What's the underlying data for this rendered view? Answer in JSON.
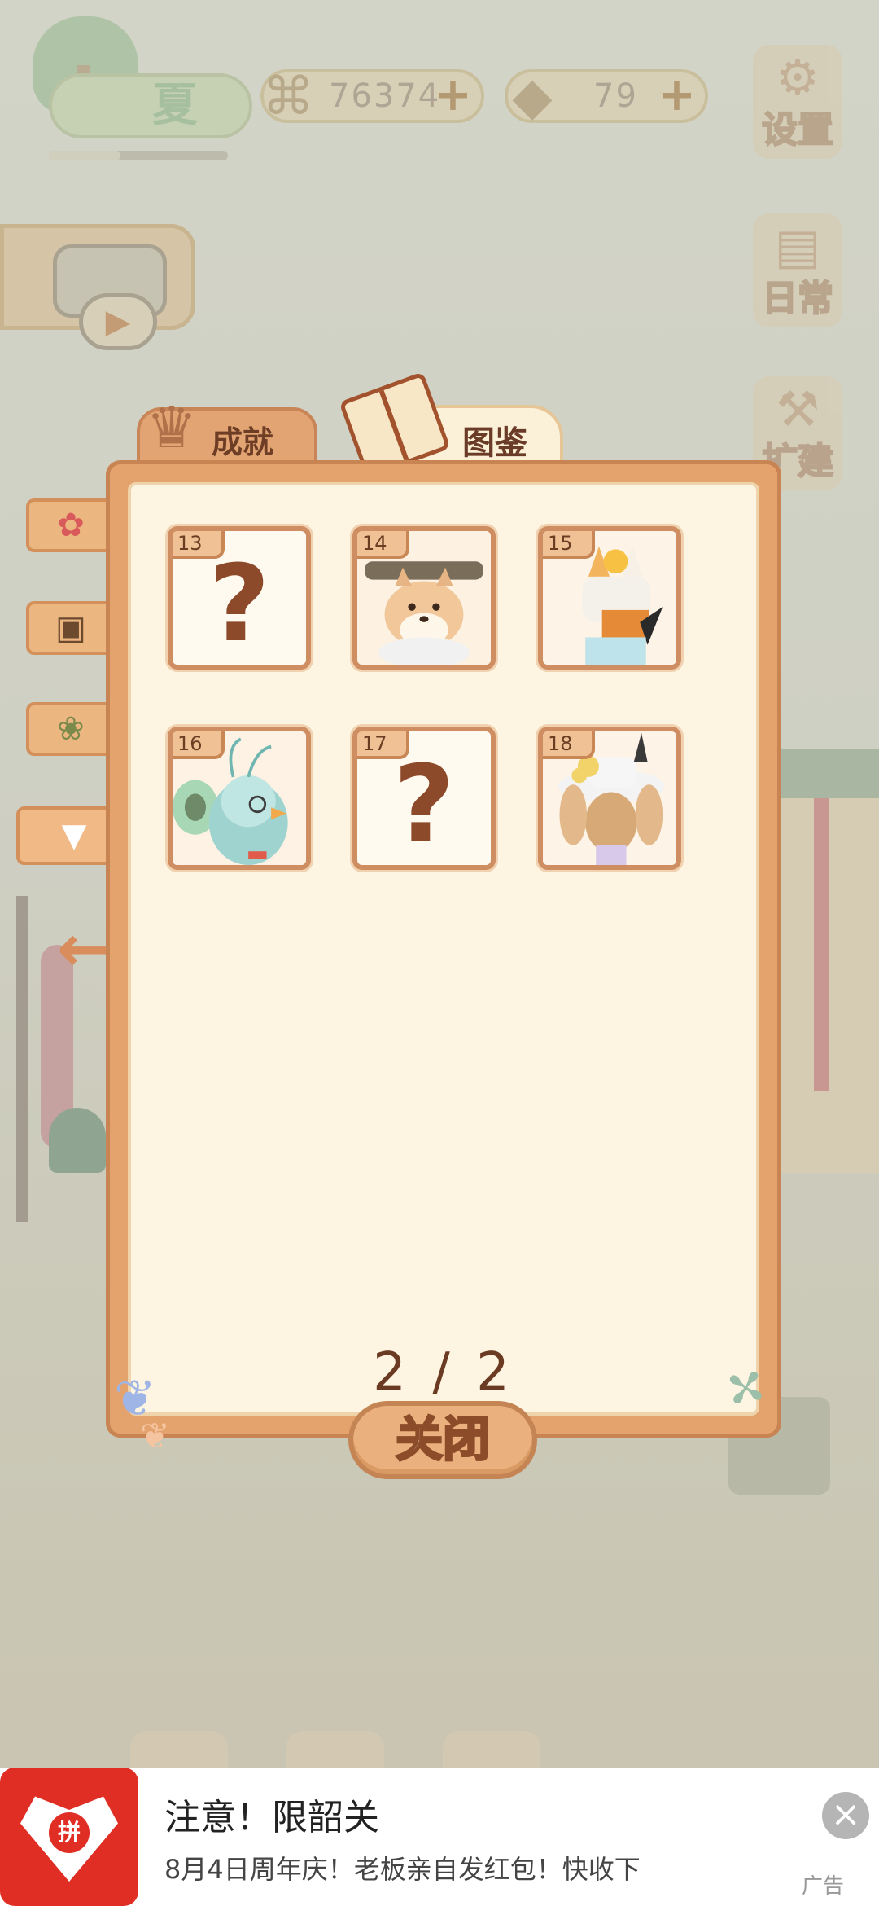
{
  "hud": {
    "season_label": "夏",
    "fish_bones": "76374",
    "cheese": "79",
    "settings_label": "设置",
    "daily_label": "日常",
    "build_label": "扩建"
  },
  "tabs": {
    "achievements": "成就",
    "collection": "图鉴"
  },
  "cards": [
    {
      "num": "13",
      "locked": true,
      "mark": "?"
    },
    {
      "num": "14",
      "locked": false,
      "name": "shiba-dog"
    },
    {
      "num": "15",
      "locked": false,
      "name": "cat-with-chick-hat"
    },
    {
      "num": "16",
      "locked": false,
      "name": "peacock"
    },
    {
      "num": "17",
      "locked": true,
      "mark": "?"
    },
    {
      "num": "18",
      "locked": false,
      "name": "rabbit-with-sunhat"
    }
  ],
  "page_indicator": "2 / 2",
  "close_label": "关闭",
  "ad": {
    "title": "注意！限韶关",
    "subtitle": "8月4日周年庆！老板亲自发红包！快收下",
    "label": "广告",
    "logo_text": "拼"
  },
  "colors": {
    "panel": "#e4a36c",
    "panel_inner": "#fdf4e1",
    "card_border": "#cf8d62",
    "ad_brand": "#e02e24"
  }
}
